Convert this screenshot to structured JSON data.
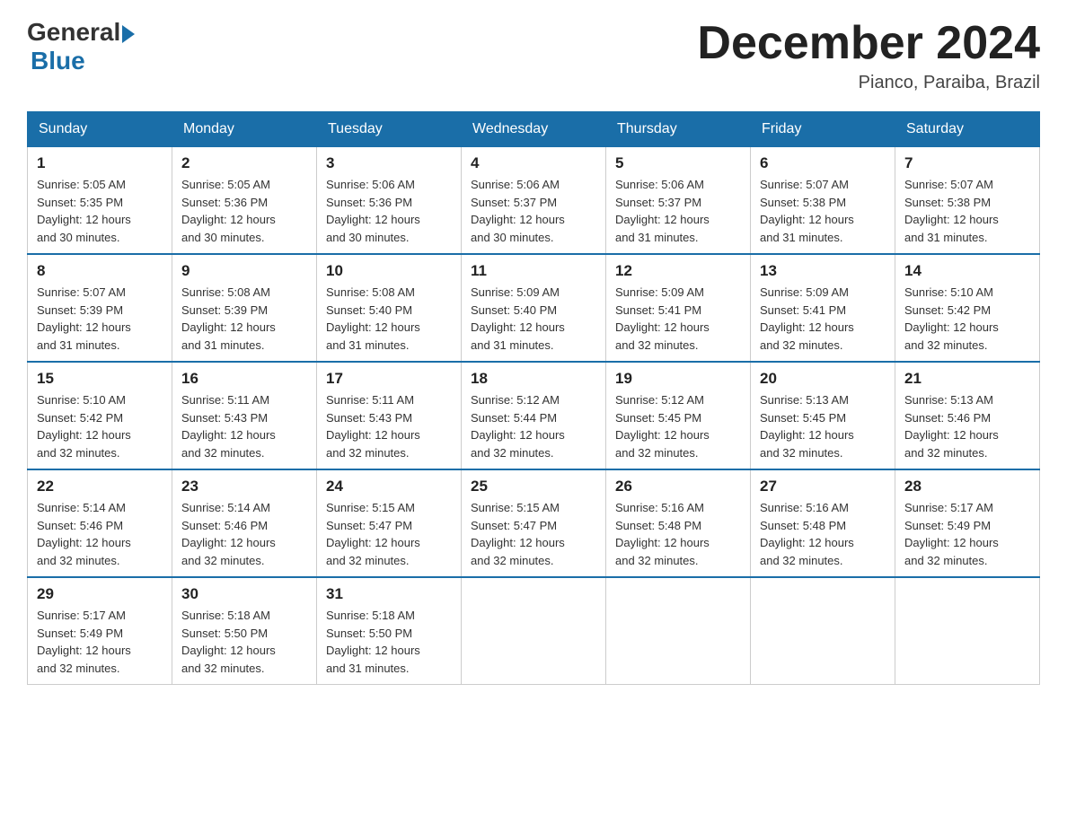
{
  "header": {
    "logo_general": "General",
    "logo_blue": "Blue",
    "month_year": "December 2024",
    "location": "Pianco, Paraiba, Brazil"
  },
  "days_of_week": [
    "Sunday",
    "Monday",
    "Tuesday",
    "Wednesday",
    "Thursday",
    "Friday",
    "Saturday"
  ],
  "weeks": [
    [
      {
        "date": "1",
        "sunrise": "5:05 AM",
        "sunset": "5:35 PM",
        "daylight": "12 hours and 30 minutes."
      },
      {
        "date": "2",
        "sunrise": "5:05 AM",
        "sunset": "5:36 PM",
        "daylight": "12 hours and 30 minutes."
      },
      {
        "date": "3",
        "sunrise": "5:06 AM",
        "sunset": "5:36 PM",
        "daylight": "12 hours and 30 minutes."
      },
      {
        "date": "4",
        "sunrise": "5:06 AM",
        "sunset": "5:37 PM",
        "daylight": "12 hours and 30 minutes."
      },
      {
        "date": "5",
        "sunrise": "5:06 AM",
        "sunset": "5:37 PM",
        "daylight": "12 hours and 31 minutes."
      },
      {
        "date": "6",
        "sunrise": "5:07 AM",
        "sunset": "5:38 PM",
        "daylight": "12 hours and 31 minutes."
      },
      {
        "date": "7",
        "sunrise": "5:07 AM",
        "sunset": "5:38 PM",
        "daylight": "12 hours and 31 minutes."
      }
    ],
    [
      {
        "date": "8",
        "sunrise": "5:07 AM",
        "sunset": "5:39 PM",
        "daylight": "12 hours and 31 minutes."
      },
      {
        "date": "9",
        "sunrise": "5:08 AM",
        "sunset": "5:39 PM",
        "daylight": "12 hours and 31 minutes."
      },
      {
        "date": "10",
        "sunrise": "5:08 AM",
        "sunset": "5:40 PM",
        "daylight": "12 hours and 31 minutes."
      },
      {
        "date": "11",
        "sunrise": "5:09 AM",
        "sunset": "5:40 PM",
        "daylight": "12 hours and 31 minutes."
      },
      {
        "date": "12",
        "sunrise": "5:09 AM",
        "sunset": "5:41 PM",
        "daylight": "12 hours and 32 minutes."
      },
      {
        "date": "13",
        "sunrise": "5:09 AM",
        "sunset": "5:41 PM",
        "daylight": "12 hours and 32 minutes."
      },
      {
        "date": "14",
        "sunrise": "5:10 AM",
        "sunset": "5:42 PM",
        "daylight": "12 hours and 32 minutes."
      }
    ],
    [
      {
        "date": "15",
        "sunrise": "5:10 AM",
        "sunset": "5:42 PM",
        "daylight": "12 hours and 32 minutes."
      },
      {
        "date": "16",
        "sunrise": "5:11 AM",
        "sunset": "5:43 PM",
        "daylight": "12 hours and 32 minutes."
      },
      {
        "date": "17",
        "sunrise": "5:11 AM",
        "sunset": "5:43 PM",
        "daylight": "12 hours and 32 minutes."
      },
      {
        "date": "18",
        "sunrise": "5:12 AM",
        "sunset": "5:44 PM",
        "daylight": "12 hours and 32 minutes."
      },
      {
        "date": "19",
        "sunrise": "5:12 AM",
        "sunset": "5:45 PM",
        "daylight": "12 hours and 32 minutes."
      },
      {
        "date": "20",
        "sunrise": "5:13 AM",
        "sunset": "5:45 PM",
        "daylight": "12 hours and 32 minutes."
      },
      {
        "date": "21",
        "sunrise": "5:13 AM",
        "sunset": "5:46 PM",
        "daylight": "12 hours and 32 minutes."
      }
    ],
    [
      {
        "date": "22",
        "sunrise": "5:14 AM",
        "sunset": "5:46 PM",
        "daylight": "12 hours and 32 minutes."
      },
      {
        "date": "23",
        "sunrise": "5:14 AM",
        "sunset": "5:46 PM",
        "daylight": "12 hours and 32 minutes."
      },
      {
        "date": "24",
        "sunrise": "5:15 AM",
        "sunset": "5:47 PM",
        "daylight": "12 hours and 32 minutes."
      },
      {
        "date": "25",
        "sunrise": "5:15 AM",
        "sunset": "5:47 PM",
        "daylight": "12 hours and 32 minutes."
      },
      {
        "date": "26",
        "sunrise": "5:16 AM",
        "sunset": "5:48 PM",
        "daylight": "12 hours and 32 minutes."
      },
      {
        "date": "27",
        "sunrise": "5:16 AM",
        "sunset": "5:48 PM",
        "daylight": "12 hours and 32 minutes."
      },
      {
        "date": "28",
        "sunrise": "5:17 AM",
        "sunset": "5:49 PM",
        "daylight": "12 hours and 32 minutes."
      }
    ],
    [
      {
        "date": "29",
        "sunrise": "5:17 AM",
        "sunset": "5:49 PM",
        "daylight": "12 hours and 32 minutes."
      },
      {
        "date": "30",
        "sunrise": "5:18 AM",
        "sunset": "5:50 PM",
        "daylight": "12 hours and 32 minutes."
      },
      {
        "date": "31",
        "sunrise": "5:18 AM",
        "sunset": "5:50 PM",
        "daylight": "12 hours and 31 minutes."
      },
      null,
      null,
      null,
      null
    ]
  ],
  "labels": {
    "sunrise_prefix": "Sunrise: ",
    "sunset_prefix": "Sunset: ",
    "daylight_prefix": "Daylight: "
  }
}
